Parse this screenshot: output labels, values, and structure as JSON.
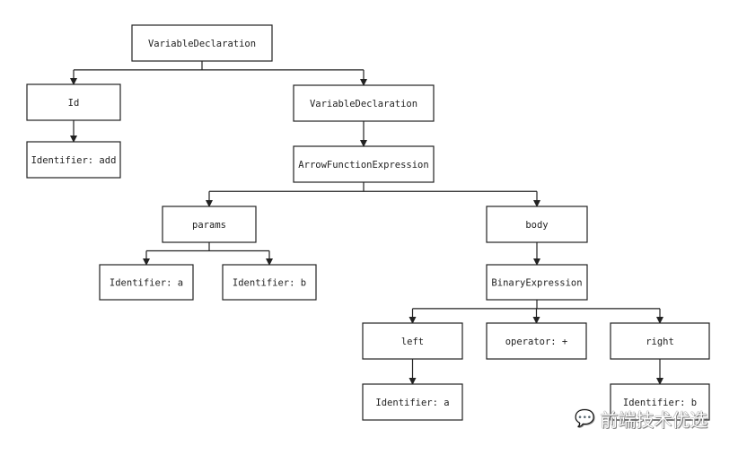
{
  "diagram": {
    "type": "tree",
    "nodes": [
      {
        "id": "vd1",
        "label": "VariableDeclaration"
      },
      {
        "id": "id",
        "label": "Id"
      },
      {
        "id": "idadd",
        "label": "Identifier: add"
      },
      {
        "id": "vd2",
        "label": "VariableDeclaration"
      },
      {
        "id": "arrow",
        "label": "ArrowFunctionExpression"
      },
      {
        "id": "params",
        "label": "params"
      },
      {
        "id": "body",
        "label": "body"
      },
      {
        "id": "pa",
        "label": "Identifier: a"
      },
      {
        "id": "pb",
        "label": "Identifier: b"
      },
      {
        "id": "bin",
        "label": "BinaryExpression"
      },
      {
        "id": "left",
        "label": "left"
      },
      {
        "id": "op",
        "label": "operator: +"
      },
      {
        "id": "right",
        "label": "right"
      },
      {
        "id": "la",
        "label": "Identifier: a"
      },
      {
        "id": "rb",
        "label": "Identifier: b"
      }
    ],
    "edges": [
      [
        "vd1",
        "id"
      ],
      [
        "vd1",
        "vd2"
      ],
      [
        "id",
        "idadd"
      ],
      [
        "vd2",
        "arrow"
      ],
      [
        "arrow",
        "params"
      ],
      [
        "arrow",
        "body"
      ],
      [
        "params",
        "pa"
      ],
      [
        "params",
        "pb"
      ],
      [
        "body",
        "bin"
      ],
      [
        "bin",
        "left"
      ],
      [
        "bin",
        "op"
      ],
      [
        "bin",
        "right"
      ],
      [
        "left",
        "la"
      ],
      [
        "right",
        "rb"
      ]
    ]
  },
  "watermark": {
    "text": "前端技术优选",
    "icon": "wechat-icon"
  }
}
